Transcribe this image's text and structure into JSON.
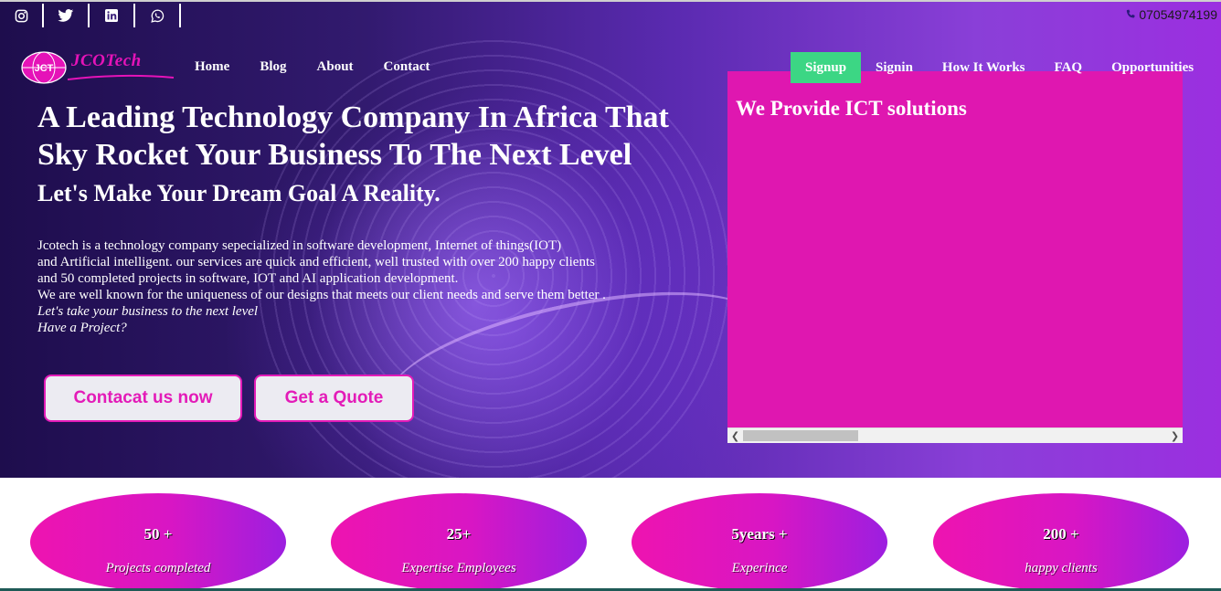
{
  "topbar": {
    "social_icons": [
      "instagram-icon",
      "twitter-icon",
      "linkedin-icon",
      "whatsapp-icon"
    ],
    "phone": "07054974199"
  },
  "brand": {
    "name": "JCOTech",
    "logo_mark": "JCT",
    "accent": "#e513b8"
  },
  "nav": {
    "left": [
      "Home",
      "Blog",
      "About",
      "Contact"
    ],
    "signup": "Signup",
    "right": [
      "Signin",
      "How It Works",
      "FAQ",
      "Opportunities"
    ]
  },
  "hero": {
    "headline": "A Leading Technology Company In Africa That Sky Rocket Your Business To The Next Level",
    "subheadline": "Let's Make Your Dream Goal A Reality.",
    "description": [
      "Jcotech is a technology company sepecialized in software development, Internet of things(IOT)",
      "and Artificial intelligent. our services are quick and efficient, well trusted with over 200 happy clients",
      "and 50 completed projects in software, IOT and AI application development.",
      "We are well known for the uniqueness of our designs that meets our client needs and serve them better ."
    ],
    "tagline_1": "Let's take your business to the next level",
    "tagline_2": "Have a Project?",
    "button_contact": "Contacat us now",
    "button_quote": "Get a Quote"
  },
  "panel": {
    "title": "We Provide ICT solutions",
    "color": "#df17b0"
  },
  "stats": [
    {
      "value": "50 +",
      "label": "Projects completed"
    },
    {
      "value": "25+",
      "label": "Expertise Employees"
    },
    {
      "value": "5years +",
      "label": "Experince"
    },
    {
      "value": "200 +",
      "label": "happy clients"
    }
  ],
  "colors": {
    "signup_bg": "#3cd684",
    "button_border": "#e31bb8"
  }
}
